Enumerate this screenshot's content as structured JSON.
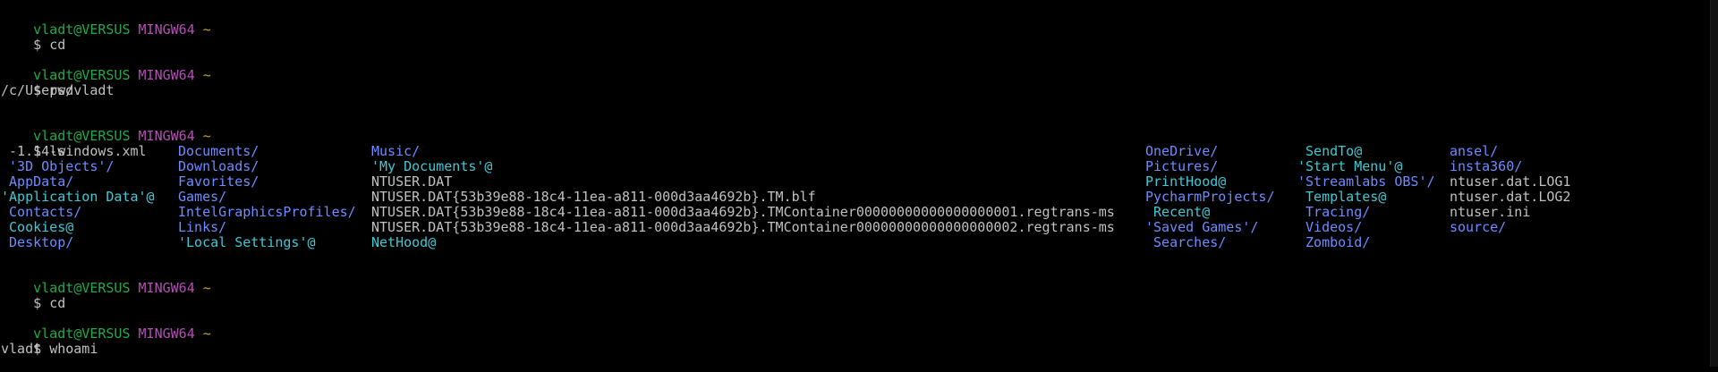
{
  "colors": {
    "background": "#000000",
    "user": "#1faa49",
    "host": "#b44fb4",
    "path": "#c9a227",
    "text": "#c0c0c0",
    "dir": "#6d8cff",
    "symlink": "#3fc9d6"
  },
  "prompt": {
    "user_host": "vladt@VERSUS",
    "shell": "MINGW64",
    "path": "~",
    "symbol": "$"
  },
  "session": [
    {
      "command": "cd",
      "output": []
    },
    {
      "command": "pwd",
      "output": [
        "/c/Users/vladt"
      ]
    },
    {
      "command": "ls"
    },
    {
      "command": "cd",
      "output": []
    },
    {
      "command": "whoami",
      "output": [
        "vladt"
      ]
    }
  ],
  "ls_listing": [
    {
      "name": " -1.14-windows.xml",
      "type": "file"
    },
    {
      "name": " '3D Objects'/",
      "type": "dir"
    },
    {
      "name": " AppData/",
      "type": "dir"
    },
    {
      "name": "'Application Data'@",
      "type": "link"
    },
    {
      "name": " Contacts/",
      "type": "dir"
    },
    {
      "name": " Cookies@",
      "type": "link"
    },
    {
      "name": " Desktop/",
      "type": "dir"
    },
    {
      "name": "Documents/",
      "type": "dir"
    },
    {
      "name": "Downloads/",
      "type": "dir"
    },
    {
      "name": "Favorites/",
      "type": "dir"
    },
    {
      "name": "Games/",
      "type": "dir"
    },
    {
      "name": "IntelGraphicsProfiles/",
      "type": "dir"
    },
    {
      "name": "Links/",
      "type": "dir"
    },
    {
      "name": "'Local Settings'@",
      "type": "link"
    },
    {
      "name": "Music/",
      "type": "dir"
    },
    {
      "name": "'My Documents'@",
      "type": "link"
    },
    {
      "name": "NTUSER.DAT",
      "type": "file"
    },
    {
      "name": "NTUSER.DAT{53b39e88-18c4-11ea-a811-000d3aa4692b}.TM.blf",
      "type": "file"
    },
    {
      "name": "NTUSER.DAT{53b39e88-18c4-11ea-a811-000d3aa4692b}.TMContainer00000000000000000001.regtrans-ms",
      "type": "file"
    },
    {
      "name": "NTUSER.DAT{53b39e88-18c4-11ea-a811-000d3aa4692b}.TMContainer00000000000000000002.regtrans-ms",
      "type": "file"
    },
    {
      "name": "NetHood@",
      "type": "link"
    },
    {
      "name": "OneDrive/",
      "type": "dir"
    },
    {
      "name": "Pictures/",
      "type": "dir"
    },
    {
      "name": "PrintHood@",
      "type": "link"
    },
    {
      "name": "PycharmProjects/",
      "type": "dir"
    },
    {
      "name": " Recent@",
      "type": "link"
    },
    {
      "name": "'Saved Games'/",
      "type": "dir"
    },
    {
      "name": " Searches/",
      "type": "dir"
    },
    {
      "name": " SendTo@",
      "type": "link"
    },
    {
      "name": "'Start Menu'@",
      "type": "link"
    },
    {
      "name": "'Streamlabs OBS'/",
      "type": "dir"
    },
    {
      "name": " Templates@",
      "type": "link"
    },
    {
      "name": " Tracing/",
      "type": "dir"
    },
    {
      "name": " Videos/",
      "type": "dir"
    },
    {
      "name": " Zomboid/",
      "type": "dir"
    },
    {
      "name": "ansel/",
      "type": "dir"
    },
    {
      "name": "insta360/",
      "type": "dir"
    },
    {
      "name": "ntuser.dat.LOG1",
      "type": "file"
    },
    {
      "name": "ntuser.dat.LOG2",
      "type": "file"
    },
    {
      "name": "ntuser.ini",
      "type": "file"
    },
    {
      "name": "source/",
      "type": "dir"
    }
  ]
}
